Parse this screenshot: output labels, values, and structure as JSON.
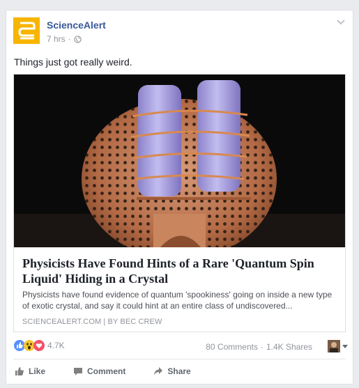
{
  "post": {
    "page_name": "ScienceAlert",
    "time": "7 hrs",
    "meta_separator": "·",
    "text": "Things just got really weird."
  },
  "link": {
    "headline": "Physicists Have Found Hints of a Rare 'Quantum Spin Liquid' Hiding in a Crystal",
    "description": "Physicists have found evidence of quantum 'spookiness' going on inside a new type of exotic crystal, and say it could hint at an entire class of undiscovered...",
    "domain": "SCIENCEALERT.COM",
    "byline_separator": "|",
    "byline": "BY BEC CREW"
  },
  "engagement": {
    "reaction_count": "4.7K",
    "comments": "80 Comments",
    "shares": "1.4K Shares",
    "stats_separator": "·",
    "reactions": [
      "like-icon",
      "wow-icon",
      "love-icon"
    ]
  },
  "actions": {
    "like": "Like",
    "comment": "Comment",
    "share": "Share"
  },
  "colors": {
    "brand_blue": "#365899",
    "avatar_yellow": "#f7b500",
    "action_gray": "#616770",
    "meta_gray": "#90949c"
  }
}
